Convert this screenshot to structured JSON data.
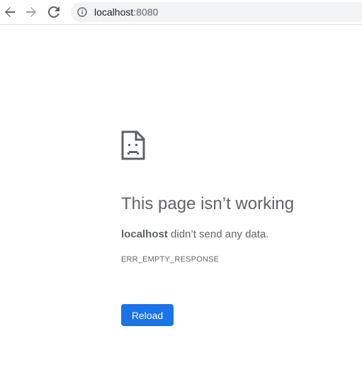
{
  "browser": {
    "url_host": "localhost",
    "url_port": ":8080",
    "icons": {
      "back": "arrow-left-icon",
      "forward": "arrow-right-icon",
      "reload": "refresh-icon",
      "site_info": "info-icon"
    }
  },
  "error_page": {
    "icon": "sad-document-icon",
    "heading": "This page isn’t working",
    "message_host": "localhost",
    "message_rest": " didn’t send any data.",
    "error_code": "ERR_EMPTY_RESPONSE",
    "reload_label": "Reload"
  },
  "colors": {
    "accent": "#1a73e8",
    "text": "#5f6368",
    "omnibox_bg": "#f1f3f4"
  }
}
